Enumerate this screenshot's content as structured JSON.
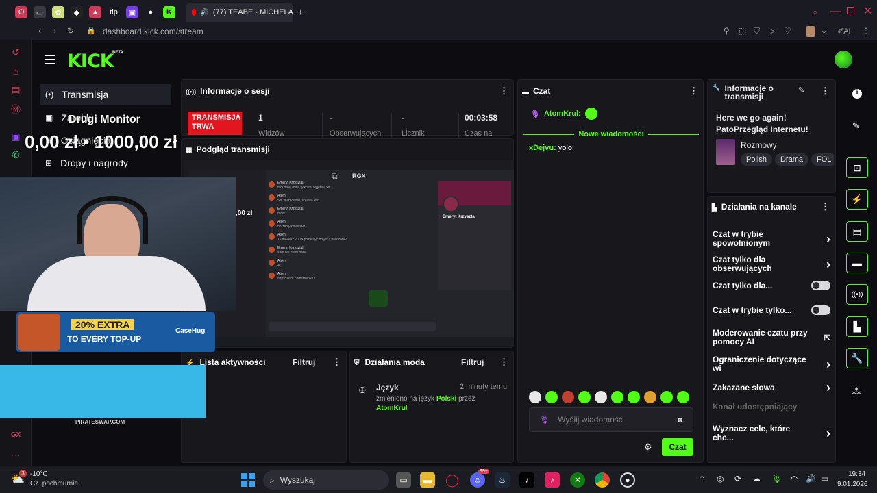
{
  "browser": {
    "tab_title": "(77) TEABE - MICHELA",
    "url": "dashboard.kick.com/stream",
    "ai_label": "AI",
    "pinned_tabs": [
      {
        "name": "opera-icon",
        "color": "#d23a5a",
        "glyph": "O"
      },
      {
        "name": "media-icon",
        "color": "#3a3a44",
        "glyph": "▭"
      },
      {
        "name": "chatgpt-icon",
        "color": "#cfe07a",
        "glyph": "✿"
      },
      {
        "name": "tiktok-pin-icon",
        "color": "#222",
        "glyph": "◆"
      },
      {
        "name": "rss-icon",
        "color": "#d23a5a",
        "glyph": "▲"
      },
      {
        "name": "tip-icon",
        "color": "#1a1a22",
        "glyph": "tip"
      },
      {
        "name": "twitch-icon",
        "color": "#7a3cf0",
        "glyph": "▣"
      },
      {
        "name": "green-dot-icon",
        "color": "#1a1a22",
        "glyph": "●"
      },
      {
        "name": "kick-tab-icon",
        "color": "#53fc18",
        "glyph": "K"
      }
    ]
  },
  "header": {
    "logo": "KICK",
    "beta": "BETA"
  },
  "nav": {
    "items": [
      {
        "label": "Transmisja",
        "icon": "broadcast-icon"
      },
      {
        "label": "Zarobki",
        "icon": "wallet-icon"
      },
      {
        "label": "Osiągnięcia",
        "icon": "trophy-icon"
      },
      {
        "label": "Dropy i nagrody",
        "icon": "gift-icon"
      }
    ]
  },
  "overlay": {
    "monitor_label": "Drugi Monitor",
    "goal_text": "0,00 zł • 1000,00 zł",
    "promo_line1": "20% EXTRA",
    "promo_line2": "TO EVERY TOP-UP",
    "promo_brand": "CaseHug",
    "pirate_label": "PIRATESWAP.COM",
    "preview_overlay_goal": ",00 zł",
    "gx_label": "GX"
  },
  "session": {
    "title": "Informacje o sesji",
    "live_badge": "TRANSMISJA TRWA",
    "stats": [
      {
        "value": "1",
        "label": "Widzów"
      },
      {
        "value": "-",
        "label": "Obserwujących"
      },
      {
        "value": "-",
        "label": "Licznik"
      },
      {
        "value": "00:03:58",
        "label": "Czas na"
      }
    ]
  },
  "preview": {
    "title": "Podgląd transmisji",
    "channel": "RGX",
    "profile_name": "Emeryt Krzysztal",
    "messages": [
      {
        "author": "Emeryt Krzysztal",
        "text": "moi dalej maja tylko mi wyjebali xd"
      },
      {
        "author": "Atom",
        "text": "Sej, Kamowski, sprawa jest"
      },
      {
        "author": "Emeryt Krzysztal",
        "text": "mów"
      },
      {
        "author": "Atom",
        "text": "bo zapły chwilowo"
      },
      {
        "author": "Atom",
        "text": "Ty możesz 200zł pożyczyć do jutra wieczora?"
      },
      {
        "author": "Emeryt Krzysztal",
        "text": "sam nie mam haha"
      },
      {
        "author": "Atom",
        "text": "Aj"
      },
      {
        "author": "Atom",
        "text": "https://kick.com/atomkrul"
      }
    ]
  },
  "activity": {
    "title": "Lista aktywności",
    "filter": "Filtruj"
  },
  "mod": {
    "title": "Działania moda",
    "filter": "Filtruj",
    "event_title": "Język",
    "event_time": "2 minuty temu",
    "event_text_1": "zmieniono na język",
    "event_lang": "Polski",
    "event_text_2": "przez",
    "event_user": "AtomKrul"
  },
  "chat": {
    "title": "Czat",
    "pinned_user": "AtomKrul:",
    "new_messages": "Nowe wiadomości",
    "messages": [
      {
        "user": "xDejvu:",
        "text": "yolo"
      }
    ],
    "input_placeholder": "Wyślij wiadomość",
    "send_label": "Czat",
    "accent": "#53fc18"
  },
  "stream_info": {
    "title": "Informacje o transmisji",
    "stream_title": "Here we go again! PatoPrzegląd Internetu!",
    "category": "Rozmowy",
    "tags": [
      "Polish",
      "Drama",
      "FOL"
    ]
  },
  "channel_actions": {
    "title": "Działania na kanale",
    "items": [
      {
        "label": "Czat w trybie spowolnionym",
        "control": "chevron"
      },
      {
        "label": "Czat tylko dla obserwujących",
        "control": "chevron"
      },
      {
        "label": "Czat tylko dla...",
        "control": "toggle"
      },
      {
        "label": "Czat w trybie tylko...",
        "control": "toggle"
      },
      {
        "label": "Moderowanie czatu przy pomocy AI",
        "control": "external"
      },
      {
        "label": "Ograniczenie dotyczące wi",
        "control": "chevron"
      },
      {
        "label": "Zakazane słowa",
        "control": "chevron"
      },
      {
        "label": "Kanał udostępniający",
        "control": "none"
      },
      {
        "label": "Wyznacz cele, które chc...",
        "control": "chevron"
      }
    ]
  },
  "taskbar": {
    "weather_temp": "-10°C",
    "weather_desc": "Cz. pochmurnie",
    "weather_badge": "3",
    "search": "Wyszukaj",
    "time": "19:34",
    "date": "9.01.2026",
    "discord_badge": "99+"
  }
}
